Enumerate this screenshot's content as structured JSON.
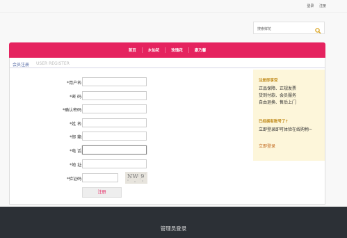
{
  "topbar": {
    "login": "登录",
    "register": "注册"
  },
  "search": {
    "placeholder": "搜索鲜花"
  },
  "nav": {
    "items": [
      "首页",
      "水仙花",
      "玫瑰花",
      "康乃馨"
    ]
  },
  "breadcrumb": {
    "title": "会员注册",
    "subtitle": "USER REGISTER"
  },
  "form": {
    "fields": [
      {
        "label": "*用户名:",
        "value": ""
      },
      {
        "label": "*密  码:",
        "value": ""
      },
      {
        "label": "*确认密码:",
        "value": ""
      },
      {
        "label": "*姓  名:",
        "value": ""
      },
      {
        "label": "*邮  箱:",
        "value": ""
      },
      {
        "label": "*电  话:",
        "value": ""
      },
      {
        "label": "*地  址:",
        "value": ""
      },
      {
        "label": "*验证码:",
        "value": ""
      }
    ],
    "captcha_text": "NW 9",
    "submit_label": "注册"
  },
  "sidebar": {
    "benefits_title": "注册即享受",
    "benefits_lines": [
      "正品保障、正规发票",
      "货到付款、会员服务",
      "自由退换、售后上门"
    ],
    "has_account_title": "已经拥有账号了?",
    "has_account_text": "立即登录即可体验在线购物~",
    "login_link": "立即登录"
  },
  "footer": {
    "admin_login": "管理员登录"
  },
  "colors": {
    "accent": "#e5235f",
    "sidebar_bg": "#fdf6da",
    "footer_bg": "#2c3036"
  }
}
